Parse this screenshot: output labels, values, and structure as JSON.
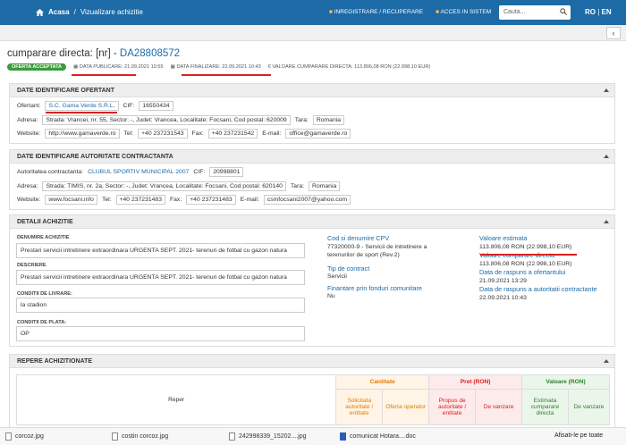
{
  "topbar": {
    "home": "Acasa",
    "separator": "/",
    "page": "Vizualizare achizitie",
    "register": "INREGISTRARE / RECUPERARE",
    "login": "ACCES IN SISTEM",
    "search_placeholder": "Cauta...",
    "lang_ro": "RO",
    "lang_sep": "|",
    "lang_en": "EN"
  },
  "header": {
    "title": "cumparare directa: [nr] - ",
    "number": "DA28808572"
  },
  "meta": {
    "badge": "OFERTA ACCEPTATA",
    "published": "DATA PUBLICARE: 21.09.2021 10:55",
    "finalized": "DATA FINALIZARE: 22.09.2021 10:43",
    "value": "VALOARE CUMPARARE DIRECTA: 113.806,08  RON (22.998,10  EUR)"
  },
  "ofertant": {
    "title": "DATE IDENTIFICARE OFERTANT",
    "ofertant_label": "Ofertant:",
    "name": "S.C. Gama Verde S.R.L.",
    "cif_label": "CIF:",
    "cif": "16550434",
    "adresa_label": "Adresa:",
    "adresa": "Strada: Vrancei, nr. 55, Sector: -, Judet: Vrancea, Localitate: Focsani, Cod postal: 620009",
    "tara_label": "Tara:",
    "tara": "Romania",
    "website_label": "Website:",
    "website": "http://www.gamaverde.ro",
    "tel_label": "Tel:",
    "tel": "+40 237231543",
    "fax_label": "Fax:",
    "fax": "+40 237231542",
    "email_label": "E-mail:",
    "email": "office@gamaverde.ro"
  },
  "autoritate": {
    "title": "DATE IDENTIFICARE AUTORITATE CONTRACTANTA",
    "aut_label": "Autoritatea contractanta:",
    "name": "CLUBUL SPORTIV MUNICIPAL 2007",
    "cif_label": "CIF:",
    "cif": "20998801",
    "adresa_label": "Adresa:",
    "adresa": "Strada: TIMIS, nr. 2a, Sector: -, Judet: Vrancea, Localitate: Focsani, Cod postal: 620140",
    "tara_label": "Tara:",
    "tara": "Romania",
    "website_label": "Website:",
    "website": "www.focsani.info",
    "tel_label": "Tel:",
    "tel": "+40 237231483",
    "fax_label": "Fax:",
    "fax": "+40 237231483",
    "email_label": "E-mail:",
    "email": "csmfocsani2007@yahoo.com"
  },
  "detalii": {
    "title": "DETALII ACHIZITIE",
    "den_label": "DENUMIRE ACHIZITIE",
    "den": "Prestari servicii intretinere extraordinara URGENTA SEPT. 2021- terenuri de fotbal cu gazon natura",
    "desc_label": "DESCRIERE",
    "desc": "Prestari servicii intretinere extraordinara URGENTA SEPT. 2021- terenuri de fotbal cu gazon natura",
    "livrare_label": "CONDITII DE LIVRARE:",
    "livrare": "la stadion",
    "plata_label": "CONDITII DE PLATA:",
    "plata": "OP",
    "cpv_label": "Cod si denumire CPV",
    "cpv": "77320000-9 - Servicii de intretinere a terenurilor de sport (Rev.2)",
    "tip_label": "Tip de contract",
    "tip": "Servicii",
    "fin_label": "Finantare prin fonduri comunitare",
    "fin": "Nu",
    "ve_label": "Valoare estimata",
    "ve": "113.806,08  RON (22.998,10  EUR)",
    "vc_label": "Valoare cumparare directa",
    "vc": "113.806,08  RON (22.998,10  EUR)",
    "dro_label": "Data de raspuns a ofertantului",
    "dro": "21.09.2021 13:29",
    "dra_label": "Data de raspuns a autoritatii contractante",
    "dra": "22.09.2021 10:43"
  },
  "repere": {
    "title": "REPERE ACHIZITIONATE",
    "reper": "Reper",
    "cantitate": "Cantitate",
    "pret": "Pret (RON)",
    "valoare": "Valoare (RON)",
    "solicitata": "Solicitata autoritate / entitate",
    "oferta": "Oferta operator",
    "propus": "Propus de autoritate / entitate",
    "vanzare": "De vanzare",
    "estimata": "Estimata cumparare directa",
    "vanzare2": "De vanzare"
  },
  "downloads": [
    "corcoz.jpg",
    "costin corcoz.jpg",
    "242998339_15202....jpg",
    "comunicat Hotara....doc"
  ],
  "show_all": "Afisati-le pe toate",
  "colors": {
    "blue": "#1c6aa6",
    "red": "#d92020",
    "green": "#3c9a3c",
    "orange": "#e07b00"
  }
}
